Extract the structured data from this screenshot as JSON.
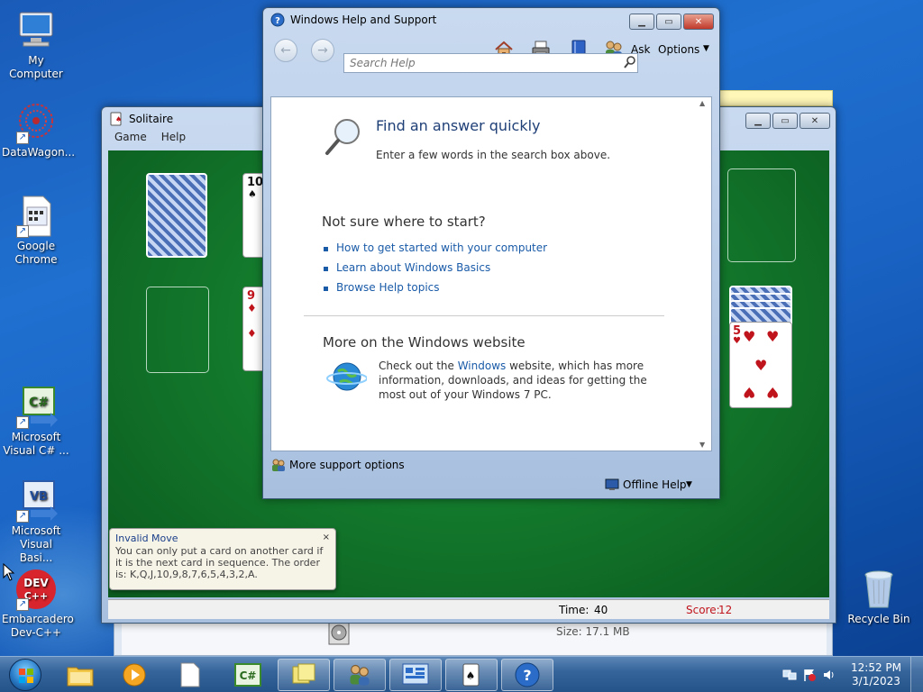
{
  "desktop": {
    "icons": [
      {
        "label": "My Computer",
        "icon": "computer-icon"
      },
      {
        "label": "DataWagon...",
        "icon": "datawagon-icon"
      },
      {
        "label": "Google Chrome",
        "icon": "chrome-doc-icon"
      },
      {
        "label": "Microsoft Visual C# ...",
        "icon": "visual-csharp-icon"
      },
      {
        "label": "Microsoft Visual Basi...",
        "icon": "visual-basic-icon"
      },
      {
        "label": "Embarcadero Dev-C++",
        "icon": "devcpp-icon"
      },
      {
        "label": "Recycle Bin",
        "icon": "recycle-bin-icon"
      }
    ]
  },
  "solitaire": {
    "title": "Solitaire",
    "menu": [
      "Game",
      "Help"
    ],
    "stock_card_rank": "10",
    "tableau_card_rank": "9",
    "foundation_card_rank": "5",
    "status": {
      "time_label": "Time:",
      "time_value": "40",
      "score_label": "Score:",
      "score_value": "12"
    }
  },
  "tooltip": {
    "title": "Invalid Move",
    "body": "You can only put a card on another card if it is the next card in sequence. The order is: K,Q,J,10,9,8,7,6,5,4,3,2,A.",
    "close": "×"
  },
  "explorer_fragment": {
    "size_text": "Size: 17.1 MB"
  },
  "help_window": {
    "title": "Windows Help and Support",
    "toolbar": {
      "ask_label": "Ask",
      "options_label": "Options"
    },
    "search_placeholder": "Search Help",
    "find_heading": "Find an answer quickly",
    "find_text": "Enter a few words in the search box above.",
    "not_sure_heading": "Not sure where to start?",
    "links": [
      "How to get started with your computer",
      "Learn about Windows Basics",
      "Browse Help topics"
    ],
    "more_heading": "More on the Windows website",
    "more_text_prefix": "Check out the ",
    "more_link": "Windows",
    "more_text_suffix": " website, which has more information, downloads, and ideas for getting the most out of your Windows 7 PC.",
    "support_label": "More support options",
    "offline_label": "Offline Help"
  },
  "taskbar": {
    "clock_time": "12:52 PM",
    "clock_date": "3/1/2023"
  },
  "colors": {
    "felt": "#137a2c",
    "link": "#1a5ba8",
    "score_red": "#c0141c"
  }
}
